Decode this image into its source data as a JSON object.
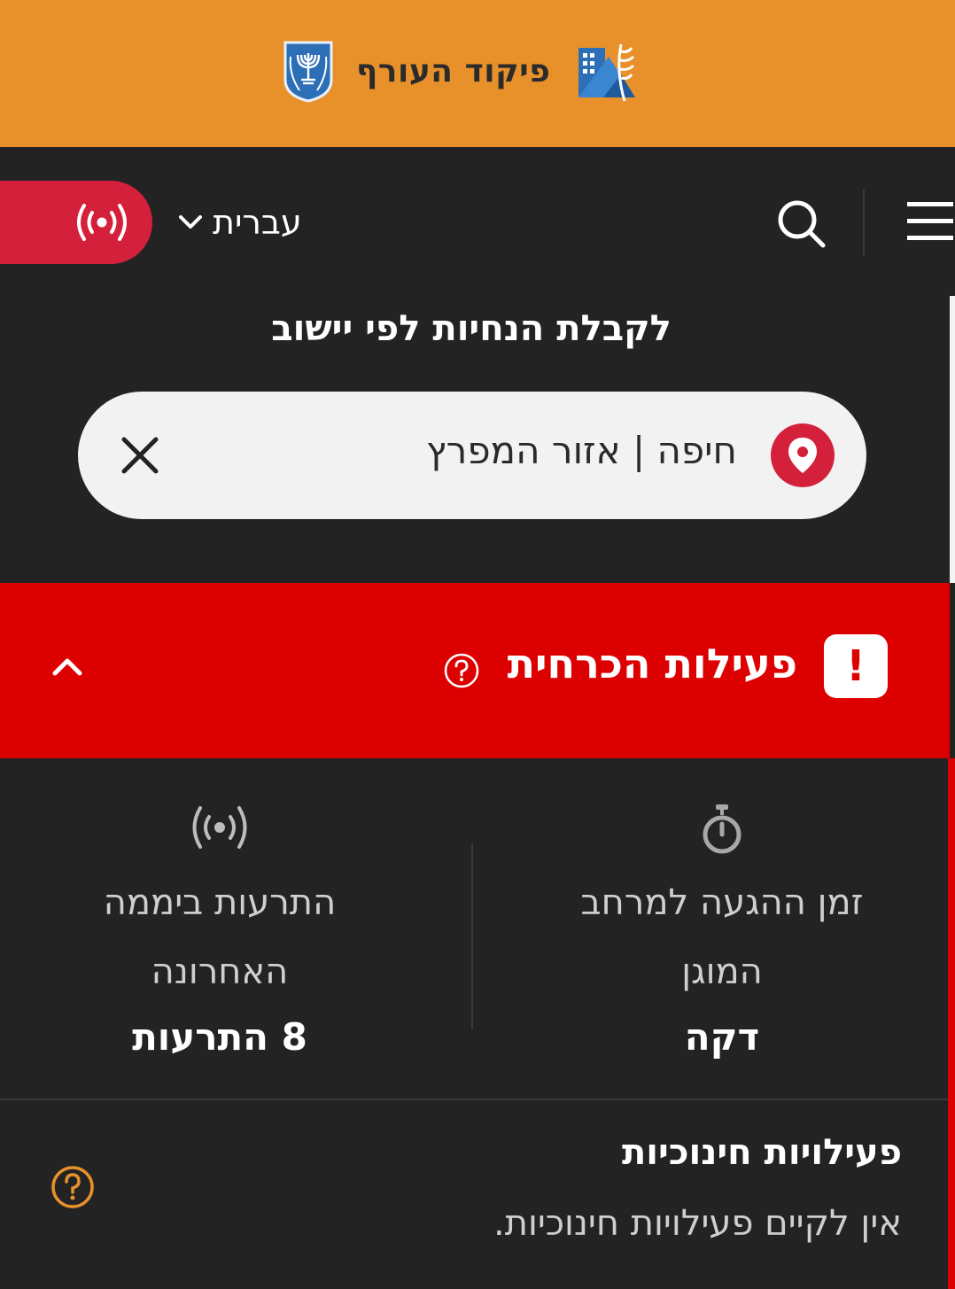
{
  "header": {
    "title": "פיקוד העורף",
    "colors": {
      "background": "#E8912B",
      "title": "#2b2b2b"
    },
    "icons": {
      "emblem": "state-emblem-icon",
      "logo": "home-front-command-logo-icon"
    }
  },
  "nav": {
    "live_alerts_icon": "broadcast-icon",
    "language_label": "עברית",
    "language_icon": "chevron-down-icon",
    "search_icon": "search-icon",
    "menu_icon": "hamburger-menu-icon",
    "colors": {
      "live_pill": "#D4203A"
    }
  },
  "location": {
    "heading": "לקבלת הנחיות לפי יישוב",
    "search_value": "חיפה | אזור המפרץ",
    "pin_icon": "location-pin-icon",
    "clear_icon": "close-icon"
  },
  "alert": {
    "badge": "!",
    "title": "פעילות הכרחית",
    "help_icon": "question-circle-icon",
    "collapse_icon": "chevron-up-icon",
    "colors": {
      "background": "#DD0000"
    }
  },
  "stats": {
    "shelter_time": {
      "icon": "stopwatch-icon",
      "label_line1": "זמן ההגעה למרחב",
      "label_line2": "המוגן",
      "value": "דקה"
    },
    "recent_alerts": {
      "icon": "broadcast-icon",
      "label_line1": "התרעות ביממה",
      "label_line2": "האחרונה",
      "value": "8 התרעות"
    }
  },
  "education": {
    "title": "פעילויות חינוכיות",
    "text": "אין לקיים פעילויות חינוכיות.",
    "help_icon": "question-circle-icon",
    "colors": {
      "help_icon": "#E8912B"
    }
  }
}
